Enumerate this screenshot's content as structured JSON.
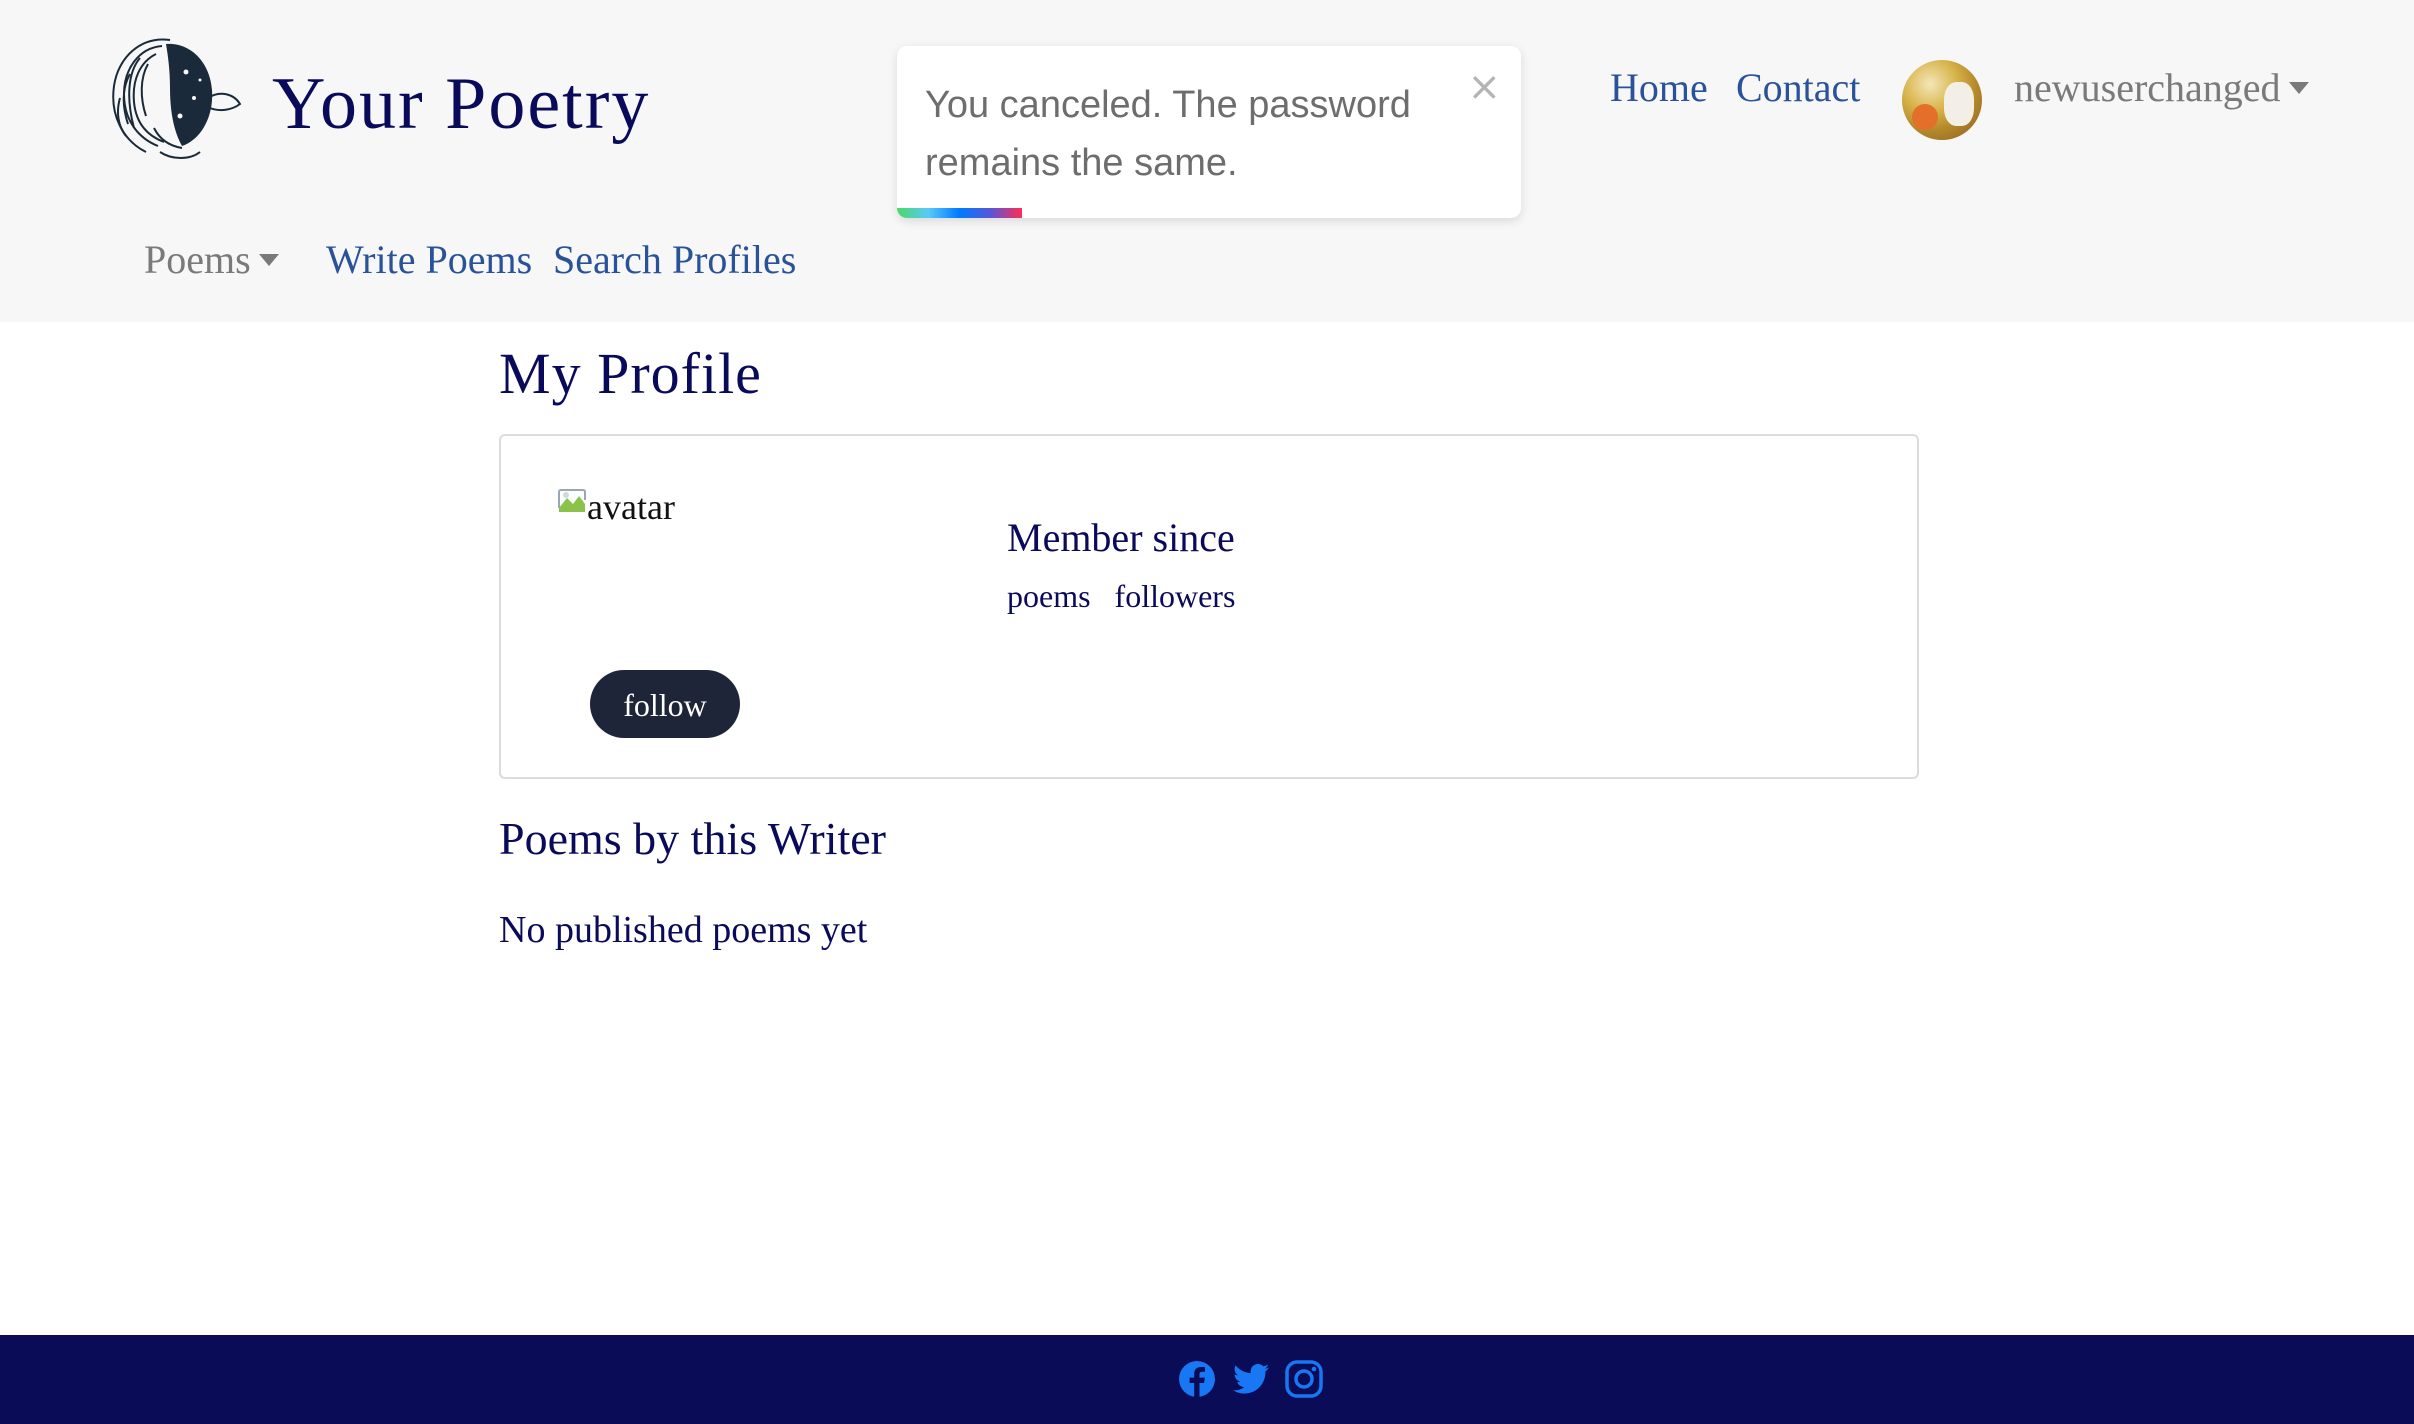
{
  "header": {
    "brand": "Your Poetry",
    "nav": {
      "home": "Home",
      "contact": "Contact"
    },
    "user": {
      "name": "newuserchanged"
    },
    "subnav": {
      "poems": "Poems",
      "write": "Write Poems",
      "search": "Search Profiles"
    }
  },
  "toast": {
    "message": "You canceled. The password remains the same.",
    "close": "×",
    "progress": 0.2,
    "progress_colors": [
      "#4cd964",
      "#5ac8fa",
      "#007aff",
      "#5856d6",
      "#ff2d55"
    ]
  },
  "main": {
    "title": "My Profile",
    "profile": {
      "avatar_alt": "avatar",
      "member_since": "Member since",
      "poems_label": "poems",
      "followers_label": "followers",
      "follow_button": "follow"
    },
    "poems_section": {
      "title": "Poems by this Writer",
      "empty": "No published poems yet"
    }
  },
  "footer": {
    "icons": [
      "facebook-icon",
      "twitter-icon",
      "instagram-icon"
    ],
    "icon_color": "#1877f2"
  },
  "colors": {
    "header_bg": "#f7f7f7",
    "text_primary": "#0a0a5a",
    "link": "#2a5298",
    "muted": "#7a7a7a",
    "footer_bg": "#0a0c57",
    "button_bg": "#1f2538"
  }
}
